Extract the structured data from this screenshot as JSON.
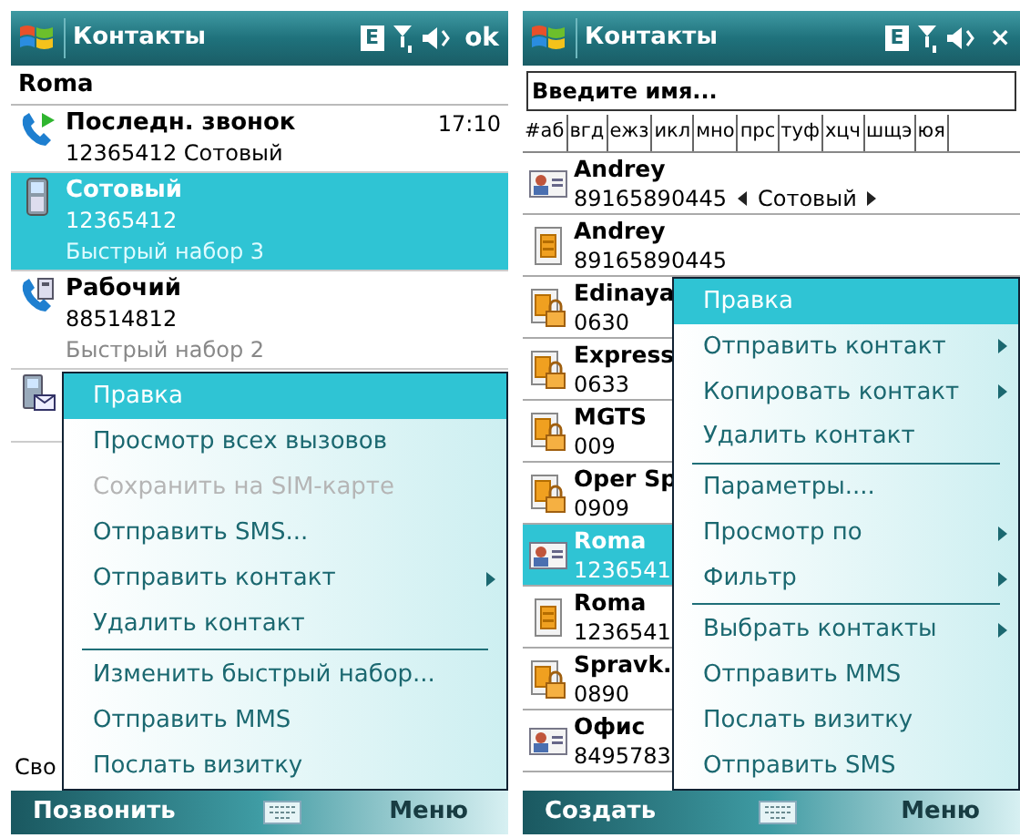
{
  "screens": [
    {
      "kind": "contact",
      "title": "Контакты",
      "network_badge": "E",
      "close": "ok",
      "contact_name": "Roma",
      "details": [
        {
          "kind": "last-call",
          "label": "Последн. звонок",
          "value": "12365412 Сотовый",
          "time": "17:10",
          "selected": false
        },
        {
          "kind": "mobile",
          "label": "Сотовый",
          "value": "12365412",
          "note": "Быстрый набор 3",
          "selected": true
        },
        {
          "kind": "work",
          "label": "Рабочий",
          "value": "88514812",
          "note": "Быстрый набор 2",
          "selected": false
        },
        {
          "kind": "message",
          "selected": false
        }
      ],
      "footer_text": "Сво",
      "menu": [
        {
          "label": "Правка",
          "selected": true,
          "disabled": false,
          "submenu": false,
          "separator_before": false
        },
        {
          "label": "Просмотр всех вызовов",
          "selected": false,
          "disabled": false,
          "submenu": false,
          "separator_before": false
        },
        {
          "label": "Сохранить на SIM-карте",
          "selected": false,
          "disabled": true,
          "submenu": false,
          "separator_before": false
        },
        {
          "label": "Отправить SMS...",
          "selected": false,
          "disabled": false,
          "submenu": false,
          "separator_before": false
        },
        {
          "label": "Отправить контакт",
          "selected": false,
          "disabled": false,
          "submenu": true,
          "separator_before": false
        },
        {
          "label": "Удалить контакт",
          "selected": false,
          "disabled": false,
          "submenu": false,
          "separator_before": false
        },
        {
          "label": "Изменить быстрый набор...",
          "selected": false,
          "disabled": false,
          "submenu": false,
          "separator_before": true
        },
        {
          "label": "Отправить MMS",
          "selected": false,
          "disabled": false,
          "submenu": false,
          "separator_before": false
        },
        {
          "label": "Послать визитку",
          "selected": false,
          "disabled": false,
          "submenu": false,
          "separator_before": false
        }
      ],
      "softkeys": {
        "left": "Позвонить",
        "right": "Меню"
      }
    },
    {
      "kind": "list",
      "title": "Контакты",
      "network_badge": "E",
      "close": "×",
      "search": {
        "placeholder": "Введите имя..."
      },
      "alphabet_tabs": [
        "#аб",
        "вгд",
        "ежз",
        "икл",
        "мно",
        "прс",
        "туф",
        "хцч",
        "шщэ",
        "юя"
      ],
      "contacts": [
        {
          "kind": "card",
          "name": "Andrey",
          "number": "89165890445",
          "number_type": "Сотовый",
          "selected": false
        },
        {
          "kind": "sim",
          "name": "Andrey",
          "number": "89165890445",
          "selected": false
        },
        {
          "kind": "locked",
          "name": "Edinaya",
          "number": "0630",
          "selected": false
        },
        {
          "kind": "locked",
          "name": "Express",
          "number": "0633",
          "selected": false
        },
        {
          "kind": "locked",
          "name": "MGTS",
          "number": "009",
          "selected": false
        },
        {
          "kind": "locked",
          "name": "Oper Sp",
          "number": "0909",
          "selected": false
        },
        {
          "kind": "card",
          "name": "Roma",
          "number": "1236541",
          "selected": true
        },
        {
          "kind": "sim",
          "name": "Roma",
          "number": "1236541",
          "selected": false
        },
        {
          "kind": "locked",
          "name": "Spravk.",
          "number": "0890",
          "selected": false
        },
        {
          "kind": "card",
          "name": "Офис",
          "number": "8495783",
          "selected": false
        }
      ],
      "menu": [
        {
          "label": "Правка",
          "selected": true,
          "disabled": false,
          "submenu": false,
          "separator_before": false
        },
        {
          "label": "Отправить контакт",
          "selected": false,
          "disabled": false,
          "submenu": true,
          "separator_before": false
        },
        {
          "label": "Копировать контакт",
          "selected": false,
          "disabled": false,
          "submenu": true,
          "separator_before": false
        },
        {
          "label": "Удалить контакт",
          "selected": false,
          "disabled": false,
          "submenu": false,
          "separator_before": false
        },
        {
          "label": "Параметры....",
          "selected": false,
          "disabled": false,
          "submenu": false,
          "separator_before": true
        },
        {
          "label": "Просмотр по",
          "selected": false,
          "disabled": false,
          "submenu": true,
          "separator_before": false
        },
        {
          "label": "Фильтр",
          "selected": false,
          "disabled": false,
          "submenu": true,
          "separator_before": false
        },
        {
          "label": "Выбрать контакты",
          "selected": false,
          "disabled": false,
          "submenu": true,
          "separator_before": true
        },
        {
          "label": "Отправить MMS",
          "selected": false,
          "disabled": false,
          "submenu": false,
          "separator_before": false
        },
        {
          "label": "Послать визитку",
          "selected": false,
          "disabled": false,
          "submenu": false,
          "separator_before": false
        },
        {
          "label": "Отправить SMS",
          "selected": false,
          "disabled": false,
          "submenu": false,
          "separator_before": false
        }
      ],
      "softkeys": {
        "left": "Создать",
        "right": "Меню"
      }
    }
  ]
}
